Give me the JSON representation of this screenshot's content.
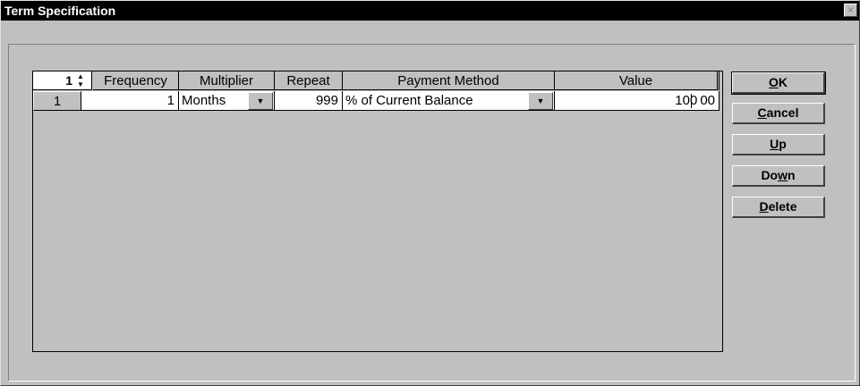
{
  "window": {
    "title": "Term Specification",
    "close_glyph": "×"
  },
  "grid": {
    "counter": "1",
    "columns": [
      "Frequency",
      "Multiplier",
      "Repeat",
      "Payment Method",
      "Value"
    ],
    "rows": [
      {
        "row_number": "1",
        "frequency": "1",
        "multiplier": "Months",
        "repeat": "999",
        "payment_method": "% of Current Balance",
        "value_int": "100",
        "value_dec": "00"
      }
    ]
  },
  "buttons": {
    "ok": {
      "mnemonic": "O",
      "rest": "K"
    },
    "cancel": {
      "mnemonic": "C",
      "rest": "ancel"
    },
    "up": {
      "mnemonic": "U",
      "rest": "p"
    },
    "down": {
      "before": "Do",
      "mnemonic": "w",
      "rest": "n"
    },
    "delete": {
      "mnemonic": "D",
      "rest": "elete"
    }
  },
  "icons": {
    "spin": "spin-updown-icon",
    "dropdown": "chevron-down-icon",
    "close": "close-icon"
  }
}
